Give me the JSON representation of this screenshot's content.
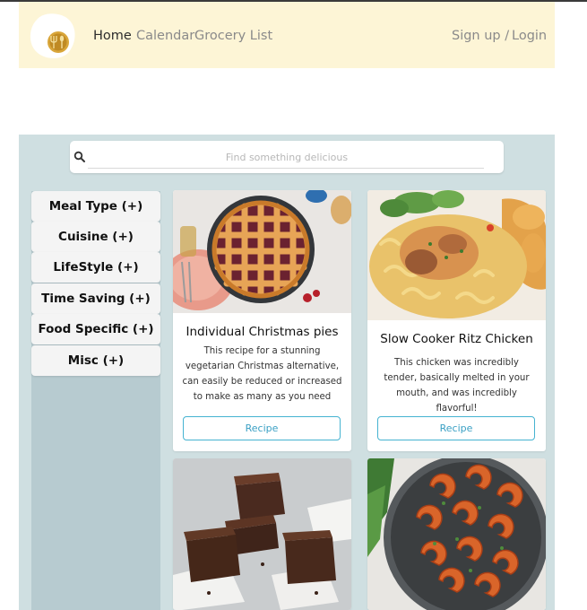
{
  "nav": {
    "home": "Home",
    "calendar": "Calendar",
    "grocery": "Grocery List",
    "signup": "Sign up /",
    "login": "Login"
  },
  "search": {
    "placeholder": "Find something delicious"
  },
  "filters": [
    "Meal Type (+)",
    "Cuisine (+)",
    "LifeStyle (+)",
    "Time Saving (+)",
    "Food Specific (+)",
    "Misc (+)"
  ],
  "recipes": [
    {
      "title": "Individual Christmas pies",
      "description": "This recipe for a stunning vegetarian Christmas alternative, can easily be reduced or increased to make as many as you need",
      "button": "Recipe",
      "image": "lattice-pie-photo"
    },
    {
      "title": "Slow Cooker Ritz Chicken",
      "description": "This chicken was incredibly tender, basically melted in your mouth, and was incredibly flavorful!",
      "button": "Recipe",
      "image": "chicken-pasta-photo"
    },
    {
      "image": "brownies-photo"
    },
    {
      "image": "shrimp-pan-photo"
    }
  ],
  "colors": {
    "navbar_bg": "#fdf5d6",
    "main_bg": "#cfdfe1",
    "sidebar_bg": "#b7cbd0",
    "button_border": "#45b3d1"
  }
}
